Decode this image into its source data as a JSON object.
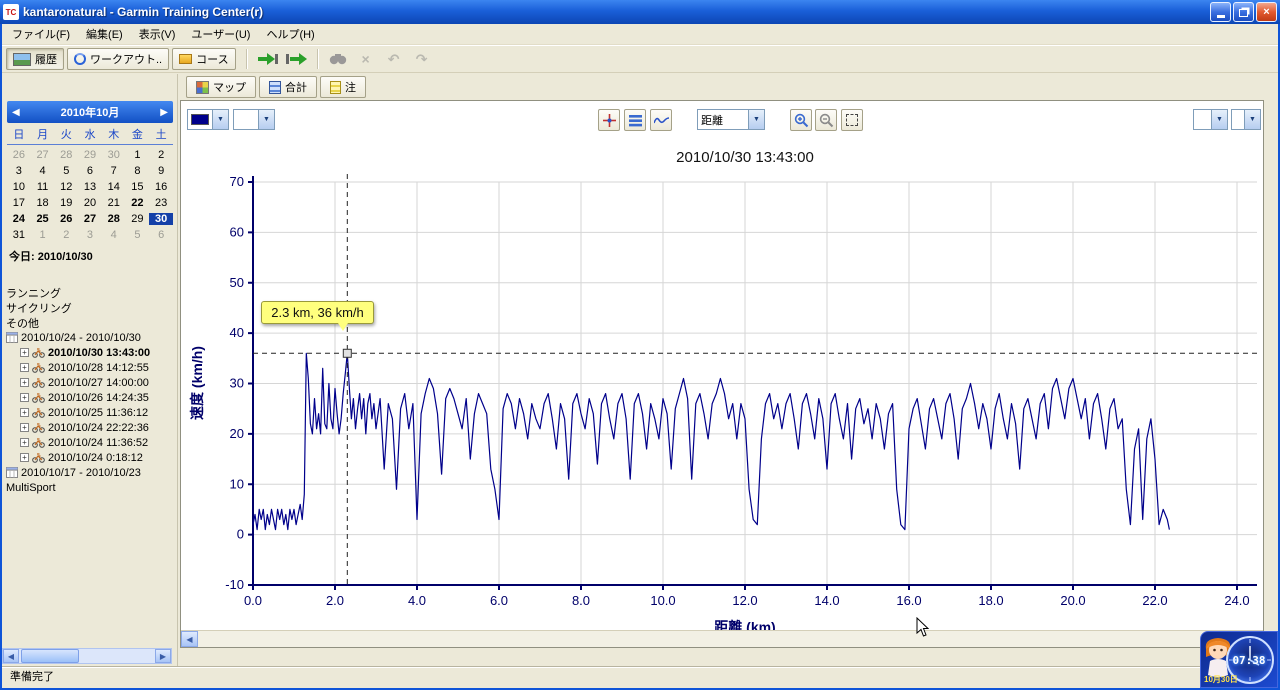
{
  "window": {
    "title": "kantaronatural - Garmin Training Center(r)",
    "app_icon_text": "TC"
  },
  "icons": {
    "dropdown_arrow": "▼",
    "cal_prev": "◀",
    "cal_next": "▶",
    "scroll_left": "◀",
    "scroll_right": "▶",
    "close": "×",
    "delete": "×",
    "undo": "↶",
    "redo": "↷",
    "expand": "+"
  },
  "menu": {
    "items": [
      {
        "label": "ファイル(F)"
      },
      {
        "label": "編集(E)"
      },
      {
        "label": "表示(V)"
      },
      {
        "label": "ユーザー(U)"
      },
      {
        "label": "ヘルプ(H)"
      }
    ]
  },
  "toolbar": {
    "history_label": "履歴",
    "workout_label": "ワークアウト..",
    "course_label": "コース"
  },
  "calendar": {
    "month_label": "2010年10月",
    "weekdays": [
      "日",
      "月",
      "火",
      "水",
      "木",
      "金",
      "土"
    ],
    "cells": [
      {
        "d": "26",
        "muted": true
      },
      {
        "d": "27",
        "muted": true
      },
      {
        "d": "28",
        "muted": true
      },
      {
        "d": "29",
        "muted": true
      },
      {
        "d": "30",
        "muted": true
      },
      {
        "d": "1"
      },
      {
        "d": "2"
      },
      {
        "d": "3"
      },
      {
        "d": "4"
      },
      {
        "d": "5"
      },
      {
        "d": "6"
      },
      {
        "d": "7"
      },
      {
        "d": "8"
      },
      {
        "d": "9"
      },
      {
        "d": "10"
      },
      {
        "d": "11"
      },
      {
        "d": "12"
      },
      {
        "d": "13"
      },
      {
        "d": "14"
      },
      {
        "d": "15"
      },
      {
        "d": "16"
      },
      {
        "d": "17"
      },
      {
        "d": "18"
      },
      {
        "d": "19"
      },
      {
        "d": "20"
      },
      {
        "d": "21"
      },
      {
        "d": "22",
        "bold": true
      },
      {
        "d": "23"
      },
      {
        "d": "24",
        "bold": true
      },
      {
        "d": "25",
        "bold": true
      },
      {
        "d": "26",
        "bold": true
      },
      {
        "d": "27",
        "bold": true
      },
      {
        "d": "28",
        "bold": true
      },
      {
        "d": "29"
      },
      {
        "d": "30",
        "selected": true
      },
      {
        "d": "31"
      },
      {
        "d": "1",
        "muted": true
      },
      {
        "d": "2",
        "muted": true
      },
      {
        "d": "3",
        "muted": true
      },
      {
        "d": "4",
        "muted": true
      },
      {
        "d": "5",
        "muted": true
      },
      {
        "d": "6",
        "muted": true
      }
    ],
    "today_label": "今日: 2010/10/30"
  },
  "activities": {
    "categories": [
      {
        "label": "ランニング"
      },
      {
        "label": "サイクリング"
      },
      {
        "label": "その他"
      }
    ],
    "week_groups": [
      {
        "label": "2010/10/24 - 2010/10/30",
        "items": [
          {
            "label": "2010/10/30 13:43:00",
            "selected": true
          },
          {
            "label": "2010/10/28 14:12:55"
          },
          {
            "label": "2010/10/27 14:00:00"
          },
          {
            "label": "2010/10/26 14:24:35"
          },
          {
            "label": "2010/10/25 11:36:12"
          },
          {
            "label": "2010/10/24 22:22:36"
          },
          {
            "label": "2010/10/24 11:36:52"
          },
          {
            "label": "2010/10/24 0:18:12"
          }
        ]
      },
      {
        "label": "2010/10/17 - 2010/10/23",
        "items": []
      }
    ],
    "multisport_label": "MultiSport"
  },
  "tabs": [
    {
      "label": "マップ"
    },
    {
      "label": "合計"
    },
    {
      "label": "注"
    }
  ],
  "chart_controls": {
    "color_value": "",
    "combo2_value": "",
    "distance_value": "距離",
    "right_combo1_value": "",
    "right_combo2_value": ""
  },
  "status": {
    "text": "準備完了"
  },
  "widget": {
    "time": "07:38",
    "date": "10月30日"
  },
  "chart_data": {
    "type": "line",
    "title": "2010/10/30 13:43:00",
    "xlabel": "距離 (km)",
    "ylabel": "速度 (km/h)",
    "xlim": [
      0,
      24.2
    ],
    "ylim": [
      -10,
      70
    ],
    "x_ticks": [
      0,
      2,
      4,
      6,
      8,
      10,
      12,
      14,
      16,
      18,
      20,
      22,
      24
    ],
    "x_tick_labels": [
      "0.0",
      "2.0",
      "4.0",
      "6.0",
      "8.0",
      "10.0",
      "12.0",
      "14.0",
      "16.0",
      "18.0",
      "20.0",
      "22.0",
      "24.0"
    ],
    "y_ticks": [
      -10,
      0,
      10,
      20,
      30,
      40,
      50,
      60,
      70
    ],
    "grid": true,
    "legend": "none",
    "line_color": "#00008b",
    "series_name": "速度",
    "tooltip": {
      "x": 2.3,
      "y": 36,
      "label": "2.3 km, 36 km/h"
    },
    "points": [
      [
        0.0,
        2
      ],
      [
        0.05,
        4
      ],
      [
        0.1,
        1
      ],
      [
        0.15,
        5
      ],
      [
        0.2,
        3
      ],
      [
        0.25,
        5
      ],
      [
        0.3,
        1
      ],
      [
        0.35,
        4
      ],
      [
        0.4,
        2
      ],
      [
        0.45,
        5
      ],
      [
        0.5,
        3
      ],
      [
        0.55,
        1
      ],
      [
        0.6,
        5
      ],
      [
        0.65,
        3
      ],
      [
        0.7,
        5
      ],
      [
        0.75,
        2
      ],
      [
        0.8,
        4
      ],
      [
        0.85,
        1
      ],
      [
        0.9,
        5
      ],
      [
        0.95,
        3
      ],
      [
        1.0,
        5
      ],
      [
        1.05,
        2
      ],
      [
        1.1,
        4
      ],
      [
        1.15,
        6
      ],
      [
        1.2,
        3
      ],
      [
        1.25,
        8
      ],
      [
        1.3,
        36
      ],
      [
        1.35,
        31
      ],
      [
        1.4,
        22
      ],
      [
        1.45,
        20
      ],
      [
        1.5,
        27
      ],
      [
        1.55,
        21
      ],
      [
        1.6,
        24
      ],
      [
        1.65,
        20
      ],
      [
        1.7,
        33
      ],
      [
        1.75,
        22
      ],
      [
        1.8,
        21
      ],
      [
        1.85,
        30
      ],
      [
        1.9,
        23
      ],
      [
        1.95,
        21
      ],
      [
        2.0,
        29
      ],
      [
        2.05,
        24
      ],
      [
        2.1,
        20
      ],
      [
        2.15,
        23
      ],
      [
        2.2,
        28
      ],
      [
        2.25,
        32
      ],
      [
        2.3,
        36
      ],
      [
        2.35,
        29
      ],
      [
        2.4,
        23
      ],
      [
        2.45,
        27
      ],
      [
        2.5,
        21
      ],
      [
        2.55,
        25
      ],
      [
        2.6,
        28
      ],
      [
        2.65,
        23
      ],
      [
        2.7,
        27
      ],
      [
        2.75,
        20
      ],
      [
        2.8,
        26
      ],
      [
        2.85,
        28
      ],
      [
        2.9,
        23
      ],
      [
        2.95,
        26
      ],
      [
        3.0,
        21
      ],
      [
        3.1,
        27
      ],
      [
        3.2,
        13
      ],
      [
        3.3,
        26
      ],
      [
        3.4,
        23
      ],
      [
        3.5,
        9
      ],
      [
        3.6,
        25
      ],
      [
        3.7,
        28
      ],
      [
        3.8,
        21
      ],
      [
        3.9,
        26
      ],
      [
        4.0,
        3
      ],
      [
        4.1,
        24
      ],
      [
        4.2,
        28
      ],
      [
        4.3,
        31
      ],
      [
        4.4,
        29
      ],
      [
        4.5,
        24
      ],
      [
        4.6,
        12
      ],
      [
        4.7,
        27
      ],
      [
        4.8,
        29
      ],
      [
        4.9,
        27
      ],
      [
        5.0,
        24
      ],
      [
        5.1,
        21
      ],
      [
        5.2,
        27
      ],
      [
        5.3,
        15
      ],
      [
        5.4,
        24
      ],
      [
        5.5,
        28
      ],
      [
        5.6,
        26
      ],
      [
        5.7,
        24
      ],
      [
        5.8,
        13
      ],
      [
        5.9,
        9
      ],
      [
        6.0,
        3
      ],
      [
        6.1,
        25
      ],
      [
        6.2,
        28
      ],
      [
        6.3,
        26
      ],
      [
        6.4,
        21
      ],
      [
        6.5,
        27
      ],
      [
        6.6,
        24
      ],
      [
        6.7,
        19
      ],
      [
        6.8,
        26
      ],
      [
        6.9,
        23
      ],
      [
        7.0,
        21
      ],
      [
        7.1,
        26
      ],
      [
        7.2,
        28
      ],
      [
        7.3,
        23
      ],
      [
        7.4,
        17
      ],
      [
        7.5,
        26
      ],
      [
        7.6,
        23
      ],
      [
        7.7,
        11
      ],
      [
        7.8,
        26
      ],
      [
        7.9,
        28
      ],
      [
        8.0,
        24
      ],
      [
        8.1,
        21
      ],
      [
        8.2,
        27
      ],
      [
        8.3,
        24
      ],
      [
        8.4,
        14
      ],
      [
        8.5,
        26
      ],
      [
        8.6,
        28
      ],
      [
        8.7,
        23
      ],
      [
        8.8,
        19
      ],
      [
        8.9,
        26
      ],
      [
        9.0,
        28
      ],
      [
        9.1,
        23
      ],
      [
        9.2,
        11
      ],
      [
        9.3,
        26
      ],
      [
        9.4,
        28
      ],
      [
        9.5,
        24
      ],
      [
        9.6,
        17
      ],
      [
        9.7,
        26
      ],
      [
        9.8,
        23
      ],
      [
        9.9,
        19
      ],
      [
        10.0,
        27
      ],
      [
        10.1,
        24
      ],
      [
        10.2,
        13
      ],
      [
        10.3,
        25
      ],
      [
        10.4,
        28
      ],
      [
        10.5,
        31
      ],
      [
        10.6,
        27
      ],
      [
        10.7,
        11
      ],
      [
        10.8,
        26
      ],
      [
        10.9,
        28
      ],
      [
        11.0,
        24
      ],
      [
        11.1,
        19
      ],
      [
        11.2,
        26
      ],
      [
        11.3,
        28
      ],
      [
        11.4,
        31
      ],
      [
        11.5,
        28
      ],
      [
        11.6,
        23
      ],
      [
        11.7,
        26
      ],
      [
        11.8,
        19
      ],
      [
        11.9,
        26
      ],
      [
        12.0,
        23
      ],
      [
        12.1,
        9
      ],
      [
        12.2,
        3
      ],
      [
        12.3,
        2
      ],
      [
        12.4,
        19
      ],
      [
        12.5,
        26
      ],
      [
        12.6,
        28
      ],
      [
        12.7,
        23
      ],
      [
        12.8,
        26
      ],
      [
        12.9,
        21
      ],
      [
        13.0,
        26
      ],
      [
        13.1,
        28
      ],
      [
        13.2,
        23
      ],
      [
        13.3,
        17
      ],
      [
        13.4,
        26
      ],
      [
        13.5,
        28
      ],
      [
        13.6,
        24
      ],
      [
        13.7,
        19
      ],
      [
        13.8,
        27
      ],
      [
        13.9,
        23
      ],
      [
        14.0,
        13
      ],
      [
        14.1,
        26
      ],
      [
        14.2,
        28
      ],
      [
        14.3,
        23
      ],
      [
        14.4,
        19
      ],
      [
        14.5,
        26
      ],
      [
        14.6,
        15
      ],
      [
        14.7,
        25
      ],
      [
        14.8,
        27
      ],
      [
        14.9,
        22
      ],
      [
        15.0,
        25
      ],
      [
        15.1,
        19
      ],
      [
        15.2,
        26
      ],
      [
        15.3,
        23
      ],
      [
        15.4,
        17
      ],
      [
        15.5,
        24
      ],
      [
        15.6,
        26
      ],
      [
        15.7,
        9
      ],
      [
        15.8,
        2
      ],
      [
        15.9,
        1
      ],
      [
        16.0,
        21
      ],
      [
        16.1,
        25
      ],
      [
        16.2,
        27
      ],
      [
        16.3,
        22
      ],
      [
        16.4,
        17
      ],
      [
        16.5,
        25
      ],
      [
        16.6,
        27
      ],
      [
        16.7,
        23
      ],
      [
        16.8,
        19
      ],
      [
        16.9,
        26
      ],
      [
        17.0,
        28
      ],
      [
        17.1,
        23
      ],
      [
        17.2,
        15
      ],
      [
        17.3,
        25
      ],
      [
        17.4,
        27
      ],
      [
        17.5,
        30
      ],
      [
        17.6,
        26
      ],
      [
        17.7,
        21
      ],
      [
        17.8,
        26
      ],
      [
        17.9,
        23
      ],
      [
        18.0,
        17
      ],
      [
        18.1,
        25
      ],
      [
        18.2,
        28
      ],
      [
        18.3,
        23
      ],
      [
        18.4,
        19
      ],
      [
        18.5,
        26
      ],
      [
        18.6,
        22
      ],
      [
        18.7,
        13
      ],
      [
        18.8,
        25
      ],
      [
        18.9,
        27
      ],
      [
        19.0,
        23
      ],
      [
        19.1,
        19
      ],
      [
        19.2,
        26
      ],
      [
        19.3,
        28
      ],
      [
        19.4,
        21
      ],
      [
        19.5,
        29
      ],
      [
        19.6,
        31
      ],
      [
        19.7,
        27
      ],
      [
        19.8,
        23
      ],
      [
        19.9,
        29
      ],
      [
        20.0,
        31
      ],
      [
        20.1,
        27
      ],
      [
        20.2,
        23
      ],
      [
        20.3,
        27
      ],
      [
        20.4,
        19
      ],
      [
        20.5,
        26
      ],
      [
        20.6,
        28
      ],
      [
        20.7,
        23
      ],
      [
        20.8,
        17
      ],
      [
        20.9,
        25
      ],
      [
        21.0,
        27
      ],
      [
        21.1,
        21
      ],
      [
        21.2,
        23
      ],
      [
        21.3,
        9
      ],
      [
        21.4,
        2
      ],
      [
        21.5,
        17
      ],
      [
        21.6,
        21
      ],
      [
        21.7,
        3
      ],
      [
        21.8,
        19
      ],
      [
        21.9,
        23
      ],
      [
        22.0,
        15
      ],
      [
        22.1,
        2
      ],
      [
        22.2,
        5
      ],
      [
        22.3,
        3
      ],
      [
        22.35,
        1
      ]
    ]
  }
}
